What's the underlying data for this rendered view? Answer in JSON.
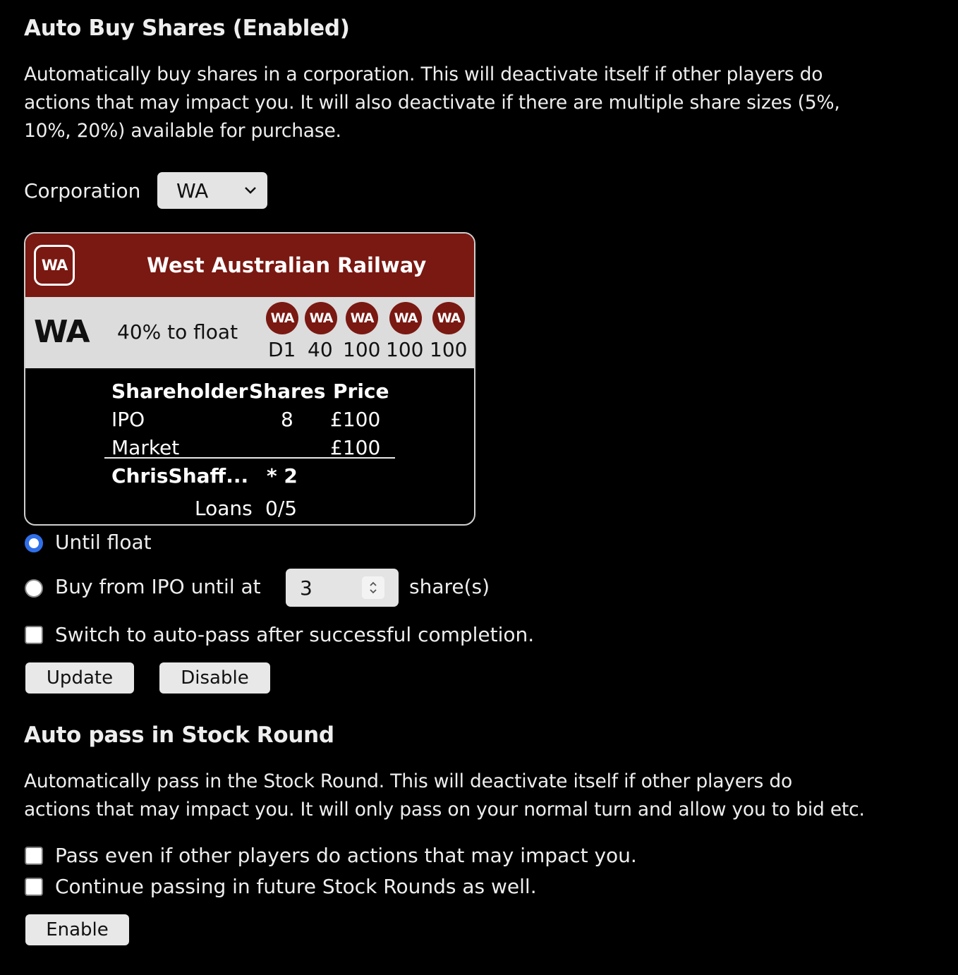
{
  "auto_buy": {
    "title": "Auto Buy Shares (Enabled)",
    "description_lines": [
      "Automatically buy shares in a corporation. This will deactivate itself if other players do",
      "actions that may impact you. It will also deactivate if there are multiple share sizes (5%,",
      "10%, 20%) available for purchase."
    ],
    "corporation_label": "Corporation",
    "corporation_selected": "WA",
    "card": {
      "logo_text": "WA",
      "name": "West Australian Railway",
      "symbol": "WA",
      "float_text": "40% to float",
      "tokens": [
        {
          "label": "WA",
          "value": "D1"
        },
        {
          "label": "WA",
          "value": "40"
        },
        {
          "label": "WA",
          "value": "100"
        },
        {
          "label": "WA",
          "value": "100"
        },
        {
          "label": "WA",
          "value": "100"
        }
      ],
      "headers": {
        "shareholder": "Shareholder",
        "shares": "Shares",
        "price": "Price"
      },
      "rows": [
        {
          "shareholder": "IPO",
          "shares": "8",
          "price": "£100"
        },
        {
          "shareholder": "Market",
          "shares": "",
          "price": "£100"
        }
      ],
      "player": {
        "name": "ChrisShaff...",
        "shares": "* 2"
      },
      "loans_label": "Loans",
      "loans_value": "0/5"
    },
    "option_until_float": "Until float",
    "option_buy_ipo": "Buy from IPO until at",
    "ipo_target_value": "3",
    "shares_suffix": "share(s)",
    "auto_pass_checkbox": "Switch to auto-pass after successful completion.",
    "update_button": "Update",
    "disable_button": "Disable",
    "brand_color": "#7a1812"
  },
  "auto_pass": {
    "title": "Auto pass in Stock Round",
    "description_lines": [
      "Automatically pass in the Stock Round. This will deactivate itself if other players do",
      "actions that may impact you. It will only pass on your normal turn and allow you to bid etc."
    ],
    "pass_even_checkbox": "Pass even if other players do actions that may impact you.",
    "continue_checkbox": "Continue passing in future Stock Rounds as well.",
    "enable_button": "Enable"
  }
}
